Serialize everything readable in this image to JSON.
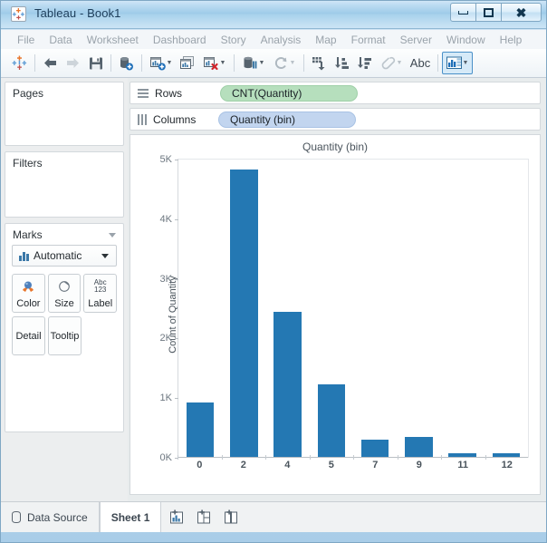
{
  "window": {
    "title": "Tableau - Book1",
    "app_icon": "tableau-icon",
    "controls": {
      "minimize": "minimize-icon",
      "maximize": "maximize-icon",
      "close": "close-icon"
    }
  },
  "menubar": {
    "items": [
      {
        "label": "File"
      },
      {
        "label": "Data"
      },
      {
        "label": "Worksheet"
      },
      {
        "label": "Dashboard"
      },
      {
        "label": "Story"
      },
      {
        "label": "Analysis"
      },
      {
        "label": "Map"
      },
      {
        "label": "Format"
      },
      {
        "label": "Server"
      },
      {
        "label": "Window"
      },
      {
        "label": "Help"
      }
    ]
  },
  "toolbar": {
    "abc_label": "Abc",
    "items": [
      {
        "name": "tableau-home-icon"
      },
      {
        "name": "back-arrow-icon"
      },
      {
        "name": "forward-arrow-icon"
      },
      {
        "name": "save-icon"
      },
      {
        "name": "new-data-source-icon"
      },
      {
        "name": "new-worksheet-icon"
      },
      {
        "name": "duplicate-sheet-icon"
      },
      {
        "name": "clear-sheet-icon"
      },
      {
        "name": "sort-pause-icon"
      },
      {
        "name": "refresh-icon"
      },
      {
        "name": "swap-rows-columns-icon"
      },
      {
        "name": "sort-ascending-icon"
      },
      {
        "name": "sort-descending-icon"
      },
      {
        "name": "highlight-icon"
      },
      {
        "name": "show-mark-labels-icon"
      },
      {
        "name": "presentation-mode-icon"
      }
    ]
  },
  "sidebar": {
    "pages": {
      "title": "Pages"
    },
    "filters": {
      "title": "Filters"
    },
    "marks": {
      "title": "Marks",
      "mark_type": "Automatic",
      "buttons": [
        {
          "label": "Color",
          "icon": "color-palette-icon"
        },
        {
          "label": "Size",
          "icon": "size-circle-icon"
        },
        {
          "label": "Label",
          "icon": "abc-123-icon"
        },
        {
          "label": "Detail",
          "icon": ""
        },
        {
          "label": "Tooltip",
          "icon": ""
        }
      ]
    }
  },
  "shelves": {
    "rows": {
      "label": "Rows",
      "pill": "CNT(Quantity)",
      "pill_color": "#b6dfbd"
    },
    "columns": {
      "label": "Columns",
      "pill": "Quantity (bin)",
      "pill_color": "#c2d5ef"
    }
  },
  "statusbar": {
    "data_source": "Data Source",
    "sheet_tab": "Sheet 1",
    "tabs": [
      {
        "name": "new-worksheet-tab-icon"
      },
      {
        "name": "new-dashboard-tab-icon"
      },
      {
        "name": "new-story-tab-icon"
      }
    ]
  },
  "chart_data": {
    "type": "bar",
    "title": "Quantity (bin)",
    "xlabel": "Quantity (bin)",
    "ylabel": "Count of Quantity",
    "categories": [
      "0",
      "2",
      "4",
      "5",
      "7",
      "9",
      "11",
      "12"
    ],
    "values": [
      930,
      4830,
      2440,
      1230,
      300,
      350,
      70,
      70
    ],
    "ylim": [
      0,
      5000
    ],
    "yticks": [
      {
        "value": 5000,
        "label": "5K"
      },
      {
        "value": 4000,
        "label": "4K"
      },
      {
        "value": 3000,
        "label": "3K"
      },
      {
        "value": 2000,
        "label": "2K"
      },
      {
        "value": 1000,
        "label": "1K"
      },
      {
        "value": 0,
        "label": "0K"
      }
    ],
    "grid": false,
    "legend": "none",
    "bar_color": "#2478b3"
  }
}
